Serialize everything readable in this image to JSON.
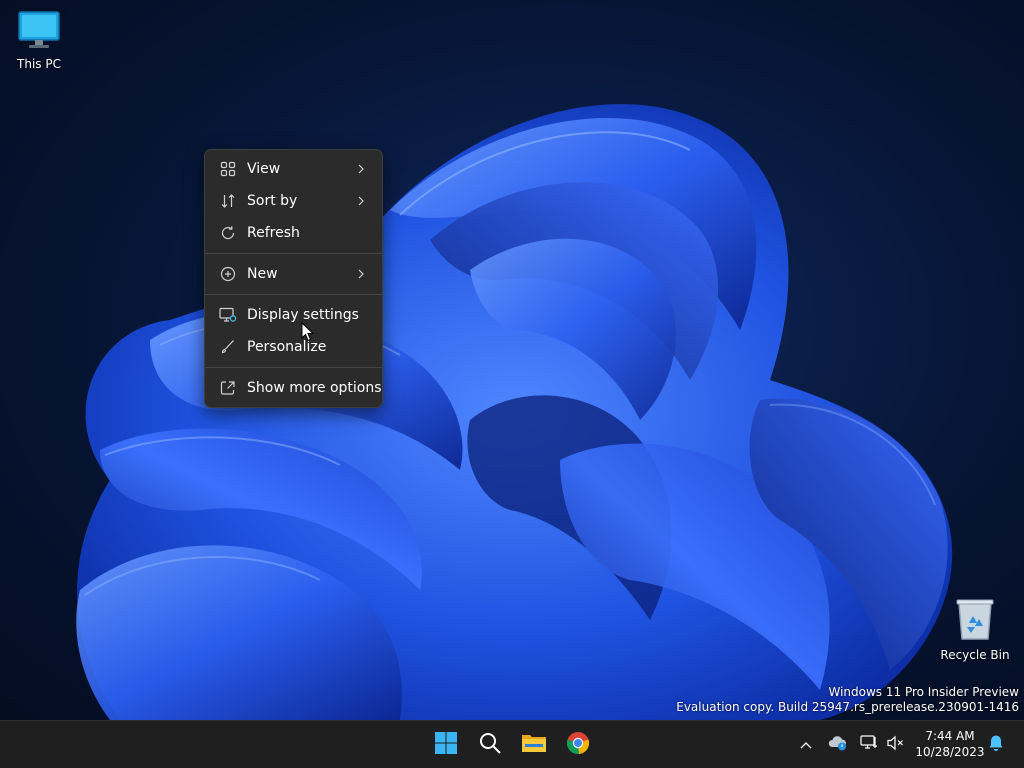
{
  "desktop": {
    "icons": [
      {
        "label": "This PC",
        "icon": "monitor-icon"
      },
      {
        "label": "Recycle Bin",
        "icon": "recycle-bin-icon"
      }
    ],
    "watermark": {
      "line1": "Windows 11 Pro Insider Preview",
      "line2": "Evaluation copy. Build 25947.rs_prerelease.230901-1416"
    }
  },
  "context_menu": {
    "items": [
      {
        "label": "View",
        "icon": "grid-view-icon",
        "submenu": true
      },
      {
        "label": "Sort by",
        "icon": "sort-icon",
        "submenu": true
      },
      {
        "label": "Refresh",
        "icon": "refresh-icon",
        "submenu": false
      },
      {
        "label": "New",
        "icon": "plus-circle-icon",
        "submenu": true
      },
      {
        "label": "Display settings",
        "icon": "display-settings-icon",
        "submenu": false
      },
      {
        "label": "Personalize",
        "icon": "brush-icon",
        "submenu": false
      },
      {
        "label": "Show more options",
        "icon": "open-external-icon",
        "submenu": false
      }
    ]
  },
  "taskbar": {
    "apps": [
      {
        "name": "Start",
        "icon": "windows-start-icon"
      },
      {
        "name": "Search",
        "icon": "search-icon"
      },
      {
        "name": "File Explorer",
        "icon": "folder-icon"
      },
      {
        "name": "Google Chrome",
        "icon": "chrome-icon"
      }
    ],
    "tray": {
      "time": "7:44 AM",
      "date": "10/28/2023"
    }
  },
  "colors": {
    "menu_bg": "#2b2b2b",
    "taskbar_bg": "#1f1f1f",
    "accent": "#0078d4",
    "notification_bell": "#4cc2ff"
  }
}
